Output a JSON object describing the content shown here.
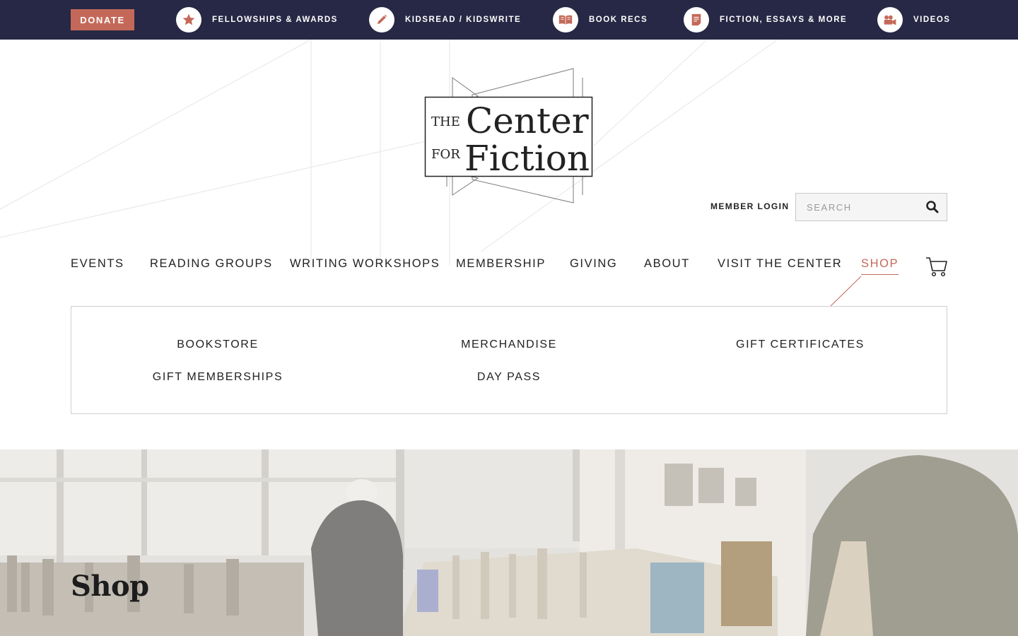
{
  "topbar": {
    "donate_label": "DONATE",
    "links": [
      {
        "label": "FELLOWSHIPS & AWARDS",
        "icon": "star-icon"
      },
      {
        "label": "KIDSREAD / KIDSWRITE",
        "icon": "pencil-icon"
      },
      {
        "label": "BOOK RECS",
        "icon": "open-book-icon"
      },
      {
        "label": "FICTION, ESSAYS & MORE",
        "icon": "document-icon"
      },
      {
        "label": "VIDEOS",
        "icon": "video-camera-icon"
      }
    ]
  },
  "logo": {
    "line1_small": "THE",
    "line1_large": "Center",
    "line2_small": "FOR",
    "line2_large": "Fiction"
  },
  "header": {
    "member_login": "MEMBER LOGIN",
    "search_placeholder": "SEARCH"
  },
  "nav": {
    "items": [
      "EVENTS",
      "READING GROUPS",
      "WRITING WORKSHOPS",
      "MEMBERSHIP",
      "GIVING",
      "ABOUT",
      "VISIT THE CENTER",
      "SHOP"
    ],
    "active": "SHOP"
  },
  "dropdown": {
    "items": [
      "BOOKSTORE",
      "MERCHANDISE",
      "GIFT CERTIFICATES",
      "GIFT MEMBERSHIPS",
      "DAY PASS"
    ]
  },
  "hero": {
    "title": "Shop"
  },
  "colors": {
    "topbar_bg": "#272845",
    "accent": "#c4695a"
  }
}
